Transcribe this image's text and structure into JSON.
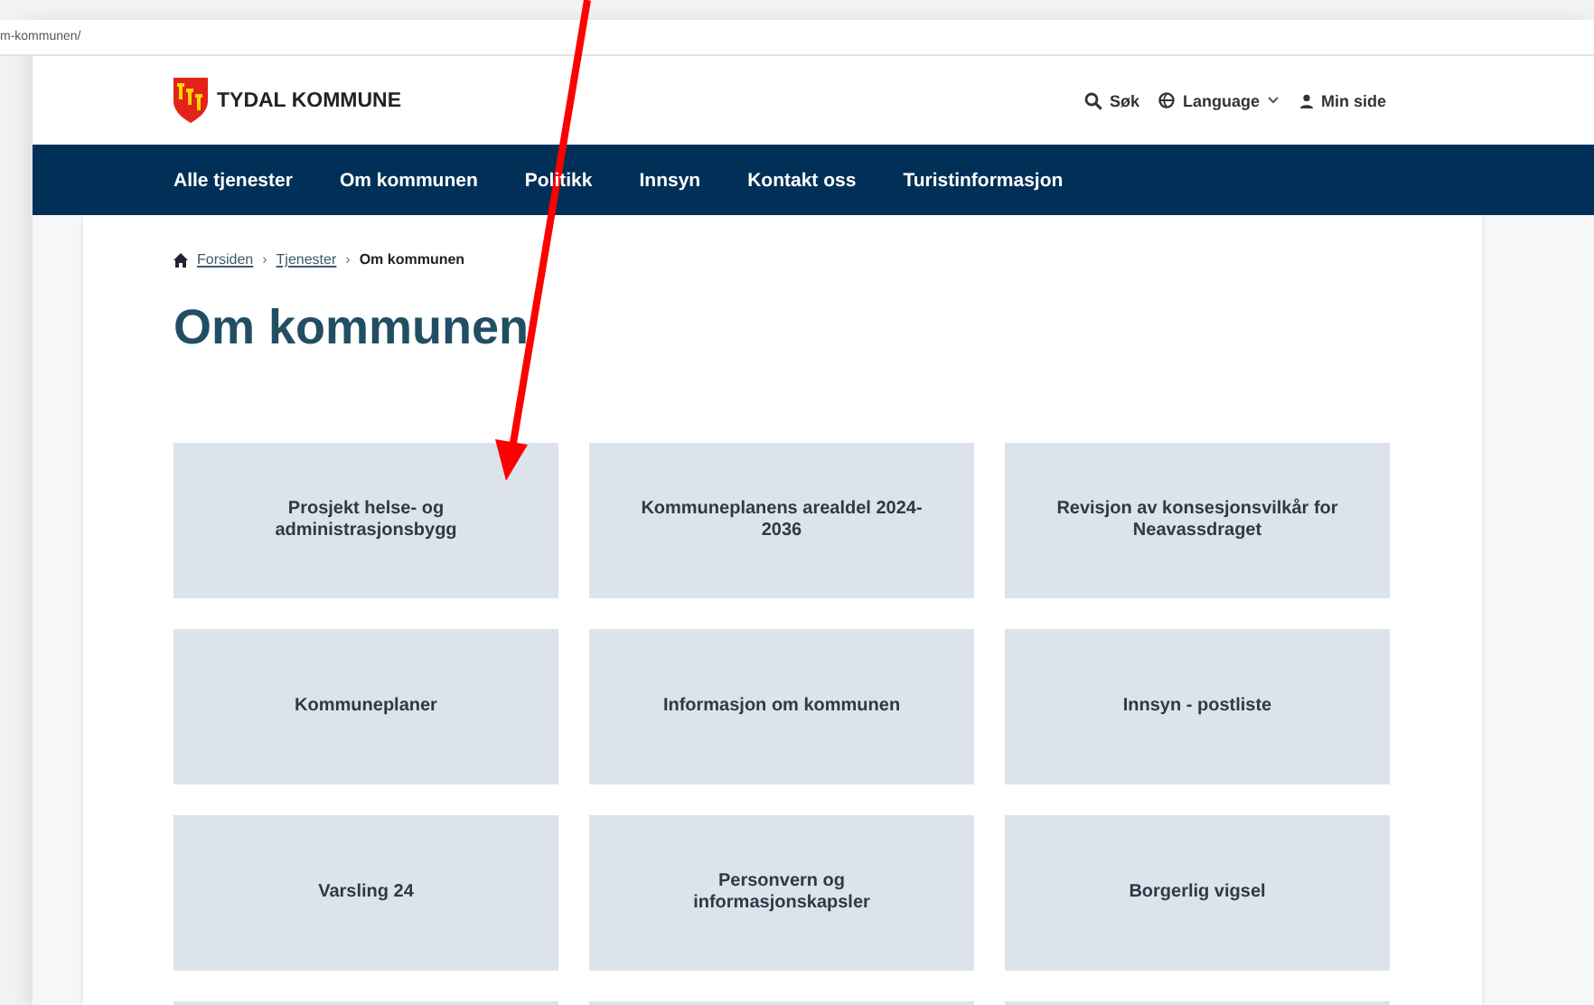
{
  "address_bar": {
    "url": "m-kommunen/"
  },
  "header": {
    "logo_text": "TYDAL KOMMUNE",
    "actions": [
      {
        "kind": "search",
        "label": "Søk"
      },
      {
        "kind": "language",
        "label": "Language"
      },
      {
        "kind": "user",
        "label": "Min side"
      }
    ]
  },
  "nav": [
    "Alle tjenester",
    "Om kommunen",
    "Politikk",
    "Innsyn",
    "Kontakt oss",
    "Turistinformasjon"
  ],
  "breadcrumb": {
    "separator": "›",
    "items": [
      {
        "label": "Forsiden",
        "link": true
      },
      {
        "label": "Tjenester",
        "link": true
      },
      {
        "label": "Om kommunen",
        "link": false
      }
    ]
  },
  "page_title": "Om kommunen",
  "tiles": [
    {
      "label": "Prosjekt helse- og administrasjonsbygg"
    },
    {
      "label": "Kommuneplanens arealdel 2024-2036"
    },
    {
      "label": "Revisjon av konsesjonsvilkår for Neavassdraget"
    },
    {
      "label": "Kommuneplaner"
    },
    {
      "label": "Informasjon om kommunen"
    },
    {
      "label": "Innsyn - postliste"
    },
    {
      "label": "Varsling 24"
    },
    {
      "label": "Personvern og informasjonskapsler"
    },
    {
      "label": "Borgerlig vigsel"
    },
    {
      "kind": "blank"
    },
    {
      "kind": "blank"
    },
    {
      "kind": "blank"
    }
  ],
  "annotation": {
    "kind": "arrow",
    "color": "#ff0000"
  }
}
